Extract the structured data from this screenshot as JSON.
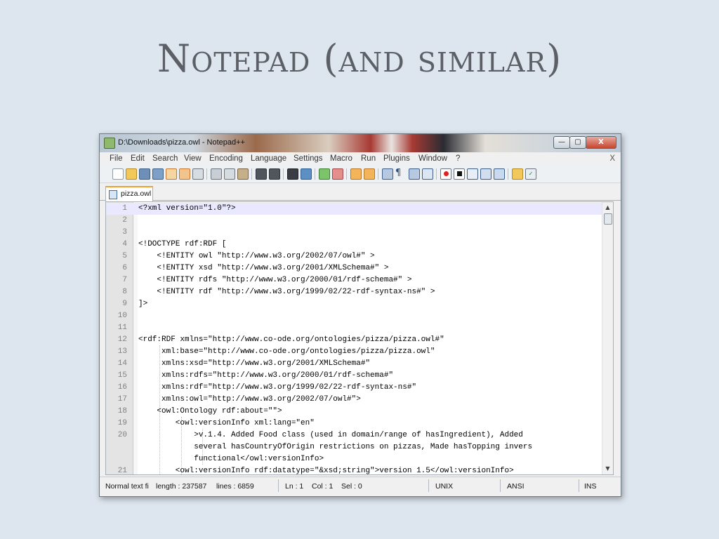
{
  "slide": {
    "title": "Notepad (and similar)"
  },
  "window": {
    "title": "D:\\Downloads\\pizza.owl - Notepad++",
    "buttons": {
      "minimize": "—",
      "maximize": "▢",
      "close": "X"
    }
  },
  "menu": {
    "items": [
      "File",
      "Edit",
      "Search",
      "View",
      "Encoding",
      "Language",
      "Settings",
      "Macro",
      "Run",
      "Plugins",
      "Window",
      "?"
    ],
    "close_label": "X"
  },
  "toolbar": {
    "icons": [
      "new-file-icon",
      "open-file-icon",
      "save-icon",
      "save-all-icon",
      "close-icon",
      "close-all-icon",
      "print-icon",
      "cut-icon",
      "copy-icon",
      "paste-icon",
      "undo-icon",
      "redo-icon",
      "find-icon",
      "replace-icon",
      "zoom-in-icon",
      "zoom-out-icon",
      "sync-vertical-icon",
      "sync-horizontal-icon",
      "word-wrap-icon",
      "show-all-chars-icon",
      "indent-guide-icon",
      "doc-map-icon",
      "record-macro-icon",
      "stop-record-icon",
      "play-macro-icon",
      "run-macro-multiple-icon",
      "save-macro-icon",
      "launch-browser-icon",
      "spell-check-icon"
    ]
  },
  "tab": {
    "label": "pizza.owl"
  },
  "editor": {
    "lines": [
      {
        "num": "1",
        "text": "<?xml version=\"1.0\"?>"
      },
      {
        "num": "2",
        "text": ""
      },
      {
        "num": "3",
        "text": ""
      },
      {
        "num": "4",
        "text": "<!DOCTYPE rdf:RDF ["
      },
      {
        "num": "5",
        "text": "    <!ENTITY owl \"http://www.w3.org/2002/07/owl#\" >"
      },
      {
        "num": "6",
        "text": "    <!ENTITY xsd \"http://www.w3.org/2001/XMLSchema#\" >"
      },
      {
        "num": "7",
        "text": "    <!ENTITY rdfs \"http://www.w3.org/2000/01/rdf-schema#\" >"
      },
      {
        "num": "8",
        "text": "    <!ENTITY rdf \"http://www.w3.org/1999/02/22-rdf-syntax-ns#\" >"
      },
      {
        "num": "9",
        "text": "]>"
      },
      {
        "num": "10",
        "text": ""
      },
      {
        "num": "11",
        "text": ""
      },
      {
        "num": "12",
        "text": "<rdf:RDF xmlns=\"http://www.co-ode.org/ontologies/pizza/pizza.owl#\""
      },
      {
        "num": "13",
        "text": "     xml:base=\"http://www.co-ode.org/ontologies/pizza/pizza.owl\""
      },
      {
        "num": "14",
        "text": "     xmlns:xsd=\"http://www.w3.org/2001/XMLSchema#\""
      },
      {
        "num": "15",
        "text": "     xmlns:rdfs=\"http://www.w3.org/2000/01/rdf-schema#\""
      },
      {
        "num": "16",
        "text": "     xmlns:rdf=\"http://www.w3.org/1999/02/22-rdf-syntax-ns#\""
      },
      {
        "num": "17",
        "text": "     xmlns:owl=\"http://www.w3.org/2002/07/owl#\">"
      },
      {
        "num": "18",
        "text": "    <owl:Ontology rdf:about=\"\">"
      },
      {
        "num": "19",
        "text": "        <owl:versionInfo xml:lang=\"en\""
      },
      {
        "num": "20",
        "text": "            >v.1.4. Added Food class (used in domain/range of hasIngredient), Added"
      },
      {
        "num": "",
        "text": "            several hasCountryOfOrigin restrictions on pizzas, Made hasTopping invers"
      },
      {
        "num": "",
        "text": "            functional</owl:versionInfo>"
      },
      {
        "num": "21",
        "text": "        <owl:versionInfo rdf:datatype=\"&xsd;string\">version 1.5</owl:versionInfo>"
      }
    ]
  },
  "status": {
    "file_type": "Normal text fi",
    "length": "length : 237587",
    "lines": "lines : 6859",
    "ln": "Ln : 1",
    "col": "Col : 1",
    "sel": "Sel : 0",
    "eol": "UNIX",
    "encoding": "ANSI",
    "mode": "INS"
  }
}
